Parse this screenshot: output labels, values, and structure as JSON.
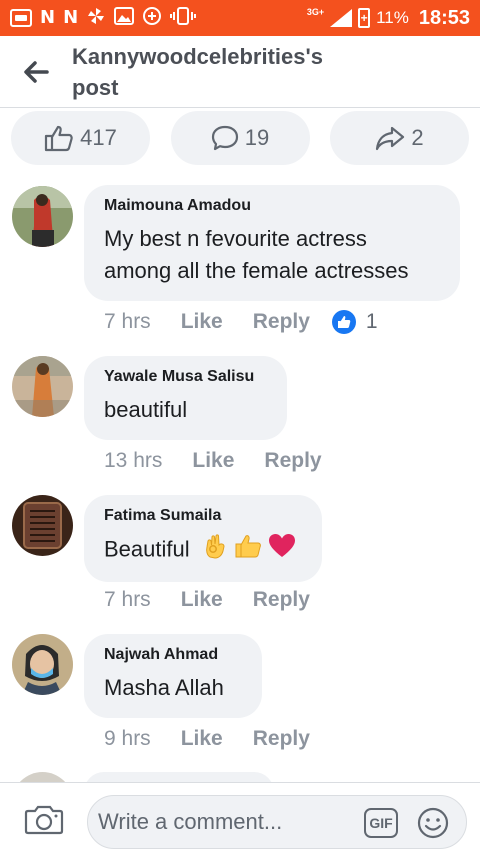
{
  "status_bar": {
    "carrier_glyphs": [
      "N",
      "N"
    ],
    "network": "3G+",
    "battery": "11%",
    "time": "18:53"
  },
  "header": {
    "title": "Kannywoodcelebrities's post",
    "back_icon": "arrow-left-icon"
  },
  "reactions": {
    "likes": "417",
    "comments": "19",
    "shares": "2"
  },
  "comments": [
    {
      "name": "Maimouna Amadou",
      "text": "My best n fevourite actress among all the female actresses",
      "time": "7 hrs",
      "like": "Like",
      "reply": "Reply",
      "reaction_count": "1"
    },
    {
      "name": "Yawale Musa Salisu",
      "text": "beautiful",
      "time": "13 hrs",
      "like": "Like",
      "reply": "Reply"
    },
    {
      "name": "Fatima Sumaila",
      "text": "Beautiful",
      "time": "7 hrs",
      "like": "Like",
      "reply": "Reply"
    },
    {
      "name": "Najwah Ahmad",
      "text": "Masha Allah",
      "time": "9 hrs",
      "like": "Like",
      "reply": "Reply"
    }
  ],
  "composer": {
    "placeholder": "Write a comment...",
    "gif_label": "GIF"
  },
  "colors": {
    "status_bar": "#f4511e",
    "accent": "#1877f2",
    "bubble": "#f0f2f5",
    "heart": "#e0245e"
  }
}
